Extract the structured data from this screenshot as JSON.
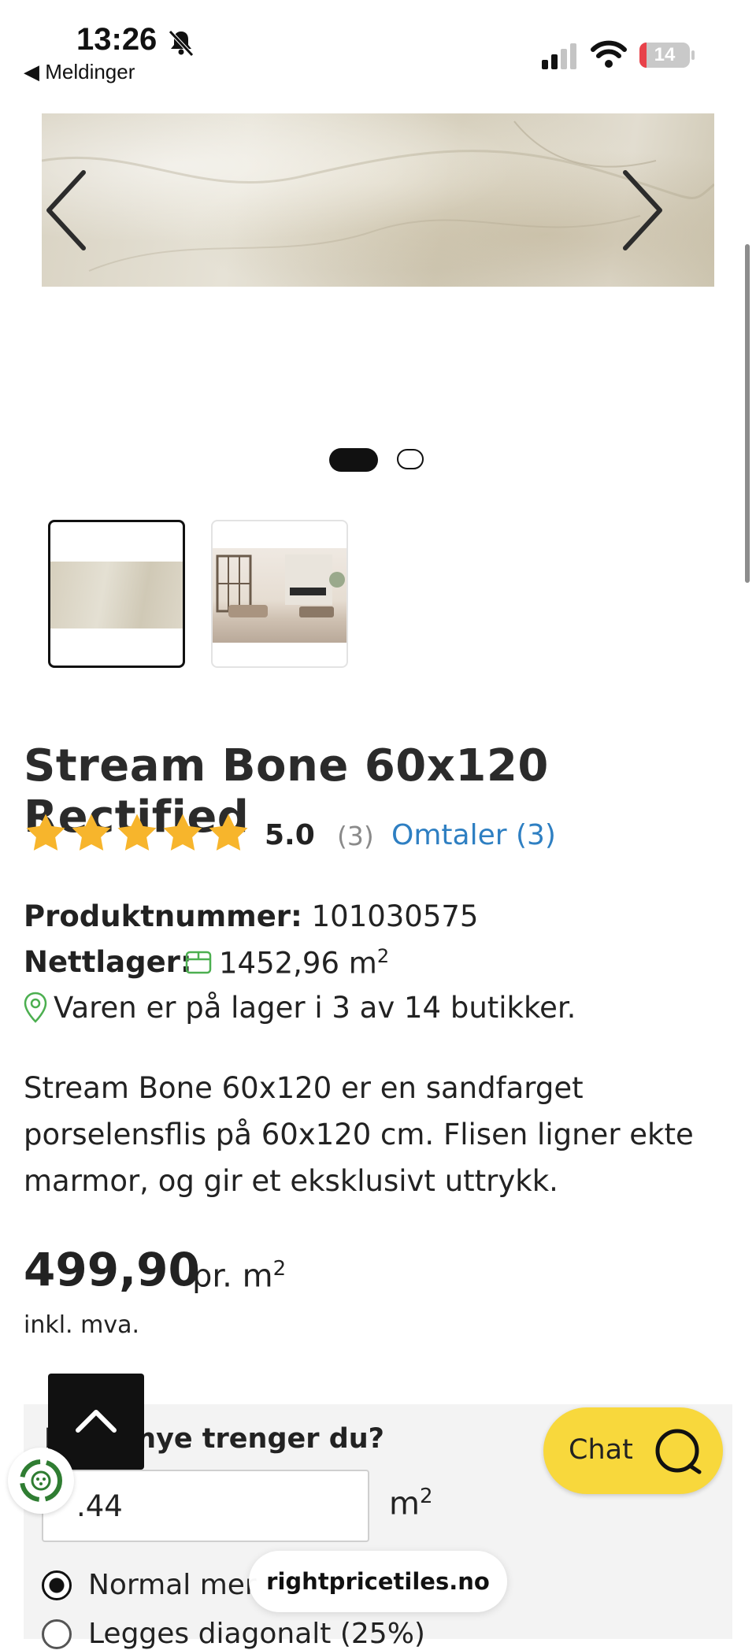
{
  "status_bar": {
    "time": "13:26",
    "back_label": "◀ Meldinger",
    "battery_level": "14",
    "battery_fraction": 0.14
  },
  "product": {
    "title": "Stream Bone 60x120 Rectified",
    "rating": {
      "stars": 5,
      "score": "5.0",
      "count": "(3)",
      "reviews_link": "Omtaler (3)",
      "star_color": "#f7b52c"
    },
    "product_number_label": "Produktnummer:",
    "product_number": "101030575",
    "stock_label": "Nettlager:",
    "stock_value": "1452,96 m",
    "stock_unit_sup": "2",
    "store_availability": "Varen er på lager i 3 av 14 butikker.",
    "description": "Stream Bone 60x120 er en sandfarget porselensflis på 60x120 cm. Flisen ligner ekte marmor, og gir et eksklusivt uttrykk.",
    "price": "499,90",
    "price_unit": "pr. m",
    "price_unit_sup": "2",
    "vat_note": "inkl. mva."
  },
  "gallery": {
    "current_slide": 1,
    "total_slides": 2,
    "thumbnails": [
      "tile-thumbnail",
      "room-thumbnail"
    ]
  },
  "quantity": {
    "label": "Hvor mye trenger du?",
    "input_value": ".44",
    "unit": "m",
    "unit_sup": "2",
    "options": [
      {
        "label": "Normal mer",
        "selected": true
      },
      {
        "label": "Legges diagonalt (25%)",
        "selected": false
      }
    ]
  },
  "chat": {
    "label": "Chat",
    "color": "#f8d83c"
  },
  "url_bar": {
    "domain": "rightpricetiles.no"
  },
  "colors": {
    "link": "#2e7fc2",
    "stock_green": "#4caf50",
    "text": "#222222"
  }
}
